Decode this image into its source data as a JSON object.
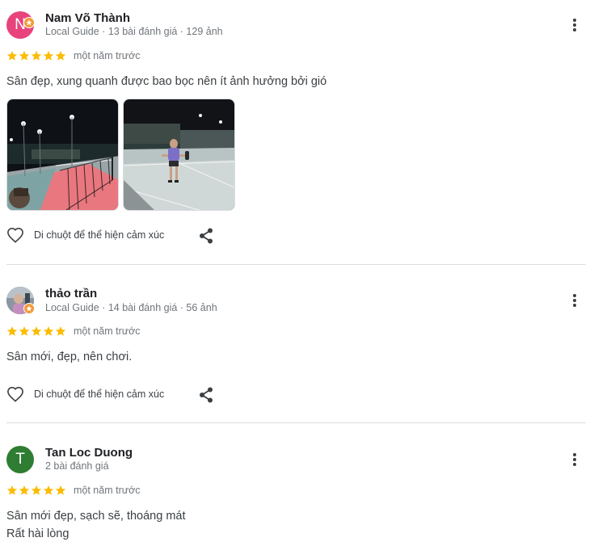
{
  "reviews": [
    {
      "author": "Nam Võ Thành",
      "avatar_letter": "N",
      "avatar_color": "#e8437c",
      "local_guide": true,
      "meta": "Local Guide · 13 bài đánh giá · 129 ảnh",
      "rating": 5,
      "time": "một năm trước",
      "text_lines": [
        "Sân đẹp, xung quanh được bao bọc nên ít ảnh hưởng bởi gió"
      ],
      "photos": [
        "court-net-photo",
        "player-on-court-photo"
      ],
      "react_label": "Di chuột để thể hiện cảm xúc"
    },
    {
      "author": "thảo trần",
      "avatar_letter": "",
      "avatar_color": "#5f6b72",
      "local_guide": true,
      "meta": "Local Guide · 14 bài đánh giá · 56 ảnh",
      "rating": 5,
      "time": "một năm trước",
      "text_lines": [
        "Sân mới, đẹp, nên chơi."
      ],
      "photos": [],
      "react_label": "Di chuột để thể hiện cảm xúc"
    },
    {
      "author": "Tan Loc Duong",
      "avatar_letter": "T",
      "avatar_color": "#2e7d32",
      "local_guide": false,
      "meta": "2 bài đánh giá",
      "rating": 5,
      "time": "một năm trước",
      "text_lines": [
        "Sân mới đẹp, sạch sẽ, thoáng mát",
        "Rất hài lòng"
      ],
      "photos": []
    }
  ],
  "colors": {
    "star": "#fbbc04",
    "secondary_text": "#70757a",
    "divider": "#dadce0"
  },
  "icons": [
    "more-vert-icon",
    "star-icon",
    "heart-outline-icon",
    "share-icon",
    "local-guide-badge-icon"
  ]
}
